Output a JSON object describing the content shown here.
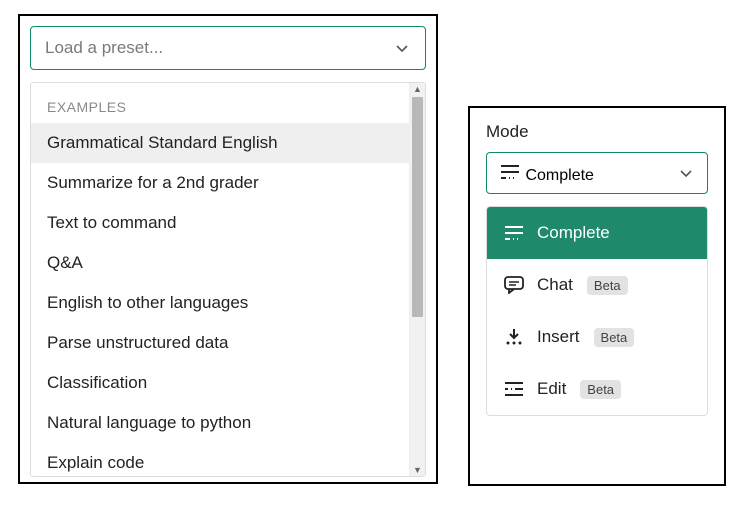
{
  "preset_dropdown": {
    "placeholder": "Load a preset...",
    "section_header": "EXAMPLES",
    "items": [
      "Grammatical Standard English",
      "Summarize for a 2nd grader",
      "Text to command",
      "Q&A",
      "English to other languages",
      "Parse unstructured data",
      "Classification",
      "Natural language to python",
      "Explain code"
    ],
    "hovered_index": 0
  },
  "mode_panel": {
    "label": "Mode",
    "selected": "Complete",
    "options": [
      {
        "label": "Complete",
        "beta": false,
        "icon": "complete"
      },
      {
        "label": "Chat",
        "beta": true,
        "icon": "chat"
      },
      {
        "label": "Insert",
        "beta": true,
        "icon": "insert"
      },
      {
        "label": "Edit",
        "beta": true,
        "icon": "edit"
      }
    ],
    "beta_label": "Beta"
  }
}
